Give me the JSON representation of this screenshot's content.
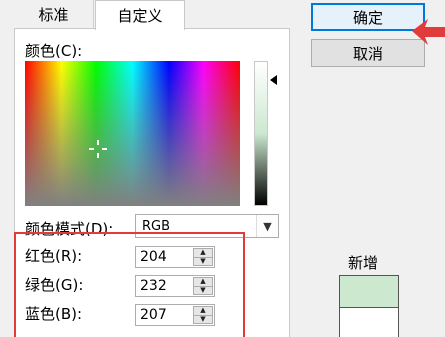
{
  "tabs": [
    {
      "label": "标准"
    },
    {
      "label": "自定义"
    }
  ],
  "colors_label": "颜色(C):",
  "color_model": {
    "label": "颜色模式(D):",
    "value": "RGB"
  },
  "fields": {
    "red": {
      "label": "红色(R):",
      "value": "204"
    },
    "green": {
      "label": "绿色(G):",
      "value": "232"
    },
    "blue": {
      "label": "蓝色(B):",
      "value": "207"
    }
  },
  "buttons": {
    "ok": "确定",
    "cancel": "取消"
  },
  "preview": {
    "new_label": "新增",
    "new_color": "#cce8cf",
    "current_color": "#ffffff"
  },
  "accent_colors": {
    "highlight_box": "#e23b3b",
    "focus_border": "#0078d7"
  }
}
